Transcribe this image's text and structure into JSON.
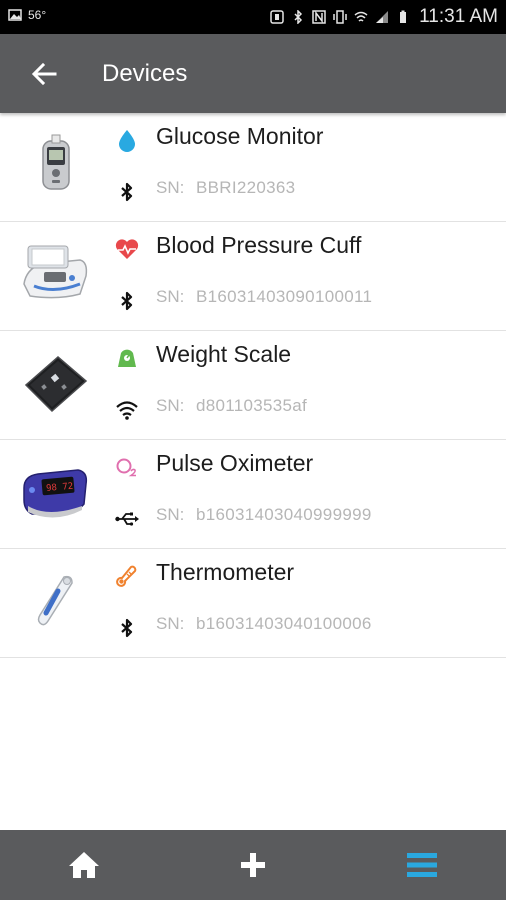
{
  "status_bar": {
    "temperature": "56°",
    "time": "11:31 AM"
  },
  "header": {
    "title": "Devices",
    "back_icon": "arrow-left-icon"
  },
  "devices": [
    {
      "name": "Glucose Monitor",
      "sn_label": "SN:",
      "sn": "BBRI220363",
      "type_icon": "droplet-icon",
      "type_color": "#29a9e1",
      "connection": "bluetooth-icon"
    },
    {
      "name": "Blood Pressure Cuff",
      "sn_label": "SN:",
      "sn": "B16031403090100011",
      "type_icon": "heart-pulse-icon",
      "type_color": "#e8484b",
      "connection": "bluetooth-icon"
    },
    {
      "name": "Weight Scale",
      "sn_label": "SN:",
      "sn": "d801103535af",
      "type_icon": "scale-icon",
      "type_color": "#61b94e",
      "connection": "wifi-icon"
    },
    {
      "name": "Pulse Oximeter",
      "sn_label": "SN:",
      "sn": "b16031403040999999",
      "type_icon": "oxygen-icon",
      "type_color": "#e06fae",
      "connection": "usb-icon"
    },
    {
      "name": "Thermometer",
      "sn_label": "SN:",
      "sn": "b16031403040100006",
      "type_icon": "thermometer-icon",
      "type_color": "#f0822f",
      "connection": "bluetooth-icon"
    }
  ],
  "bottom_nav": {
    "items": [
      {
        "icon": "home-icon",
        "color": "#ffffff"
      },
      {
        "icon": "plus-icon",
        "color": "#ffffff"
      },
      {
        "icon": "menu-icon",
        "color": "#2aa8df"
      }
    ]
  }
}
